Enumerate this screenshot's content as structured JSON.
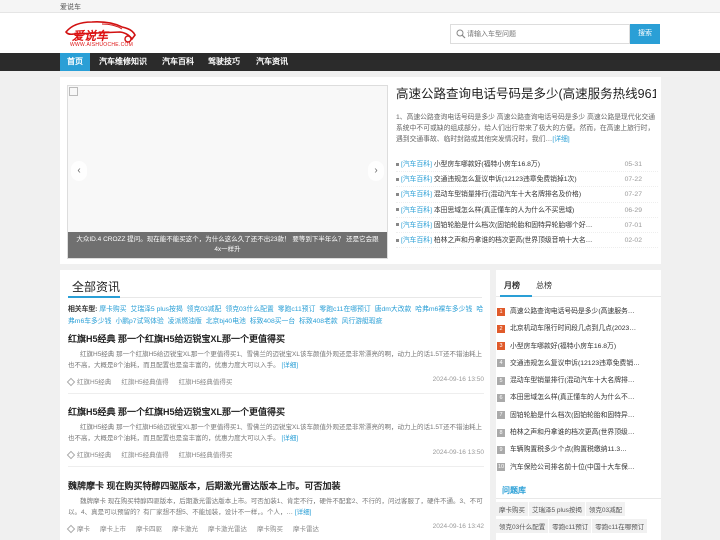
{
  "topbar": {
    "site_name": "爱说车"
  },
  "logo": {
    "brand": "爱说车",
    "url": "WWW.AISHUOCHE.COM"
  },
  "search": {
    "placeholder": "请输入车型问题",
    "button": "搜索"
  },
  "nav": [
    "首页",
    "汽车维修知识",
    "汽车百科",
    "驾驶技巧",
    "汽车资讯"
  ],
  "slider": {
    "caption": "大众ID.4 CROZZ 提问。现在能不能买这个，为什么这么久了还不出23款！ 要等到下半年么？ 还是它会跟4x一样升",
    "prev": "‹",
    "next": "›"
  },
  "feature": {
    "title": "高速公路查询电话号码是多少(高速服务热线961",
    "desc": "1、高速公路查询电话号码是多少 高速公路查询电话号码是多少 高速公路是现代化交通系统中不可或缺的组成部分，给人们出行带来了极大的方便。然而，在高速上旅行时，遇到交通事故、临时封路或其他突发情况时，我们…",
    "more": "[详细]"
  },
  "feature_list": [
    {
      "cat": "[汽车百科]",
      "title": "小型房车哪款好(福特小房车16.8万)",
      "date": "05-31"
    },
    {
      "cat": "[汽车百科]",
      "title": "交通违规怎么复议申诉(12123违章免费销掉1次)",
      "date": "07-22"
    },
    {
      "cat": "[汽车百科]",
      "title": "混动车型销量排行(混动汽车十大名牌排名及价格)",
      "date": "07-27"
    },
    {
      "cat": "[汽车百科]",
      "title": "本田思域怎么样(真正懂车的人为什么不买思域)",
      "date": "06-29"
    },
    {
      "cat": "[汽车百科]",
      "title": "固铂轮胎是什么档次(固铂轮胎和固特异轮胎哪个好…",
      "date": "07-01"
    },
    {
      "cat": "[汽车百科]",
      "title": "柏林之声和丹拿谁的档次更高(世界顶级音响十大名…",
      "date": "02-02"
    }
  ],
  "main": {
    "section_title": "全部资讯",
    "hot_label": "相关车型:",
    "hot_tags": [
      "摩卡购买",
      "艾瑞泽5 plus按揭",
      "领克03减配",
      "领克03什么配置",
      "零跑c11预订",
      "零跑c11在哪预订",
      "唐dm大改款",
      "哈弗m6裸车多少钱",
      "哈弗m6车多少钱",
      "小鹏p7试驾体验",
      "凌派燃油版",
      "北京bj40电池",
      "标致408买一台",
      "标致408老款",
      "风行游艇瑕疵"
    ],
    "articles": [
      {
        "title": "红旗H5经典 那一个红旗H5给迈锐宝XL那一个更值得买",
        "desc": "红旗H5经典 那一个红旗H5给迈锐宝XL那一个更值得买1、雪佛兰的迈锐宝XL该车颜值外观还是非常漂亮的啊，动力上的话1.5T还不错油耗上也不高，大概是8个油耗，而且配置也是蛮丰富的，优惠力度大可以入手。",
        "more": "[详细]",
        "tags": [
          "红旗H5经典",
          "红旗H5经典值得",
          "红旗H5经典值得买"
        ],
        "date": "2024-09-16 13:50"
      },
      {
        "title": "红旗H5经典 那一个红旗H5给迈锐宝XL那一个更值得买",
        "desc": "红旗H5经典 那一个红旗H5给迈锐宝XL那一个更值得买1、雪佛兰的迈锐宝XL该车颜值外观还是非常漂亮的啊，动力上的话1.5T还不错油耗上也不高，大概是8个油耗，而且配置也是蛮丰富的，优惠力度大可以入手。",
        "more": "[详细]",
        "tags": [
          "红旗H5经典",
          "红旗H5经典值得",
          "红旗H5经典值得买"
        ],
        "date": "2024-09-16 13:50"
      },
      {
        "title": "魏牌摩卡 现在购买特醇四驱版本，后期激光雷达版本上市。可否加装",
        "desc": "魏牌摩卡 现在购买特醇四驱版本，后期激光雷达版本上市。可否加装1、肯定不行，硬件不配套2、不行的，问过客服了，硬件不通。3、不可以。4、真是可以预留的？有厂家想不想5、不能加装，设计不一样，。个人，…",
        "more": "[详细]",
        "tags": [
          "摩卡",
          "摩卡上市",
          "摩卡四驱",
          "摩卡激光",
          "摩卡激光雷达",
          "摩卡购买",
          "摩卡雷达"
        ],
        "date": "2024-09-16 13:42"
      }
    ]
  },
  "sidebar": {
    "tabs": [
      "月榜",
      "总榜"
    ],
    "rank": [
      {
        "num": "1",
        "title": "高速公路查询电话号码是多少(高速服务…"
      },
      {
        "num": "2",
        "title": "北京机动车限行时间段几点到几点(2023…"
      },
      {
        "num": "3",
        "title": "小型房车哪款好(福特小房车16.8万)"
      },
      {
        "num": "4",
        "title": "交通违规怎么复议申诉(12123违章免费销…"
      },
      {
        "num": "5",
        "title": "混动车型销量排行(混动汽车十大名牌排…"
      },
      {
        "num": "6",
        "title": "本田思域怎么样(真正懂车的人为什么不…"
      },
      {
        "num": "7",
        "title": "固铂轮胎是什么档次(固铂轮胎和固特异…"
      },
      {
        "num": "8",
        "title": "柏林之声和丹拿谁的档次更高(世界顶级…"
      },
      {
        "num": "9",
        "title": "车辆购置税多少个点(购置税缴纳11.3…"
      },
      {
        "num": "10",
        "title": "汽车保险公司排名前十位(中国十大车保…"
      }
    ],
    "wenti_title": "问题库",
    "wenti_tags": [
      "摩卡购买",
      "艾瑞泽5 plus按揭",
      "领克03减配",
      "领克03什么配置",
      "零跑c11预订",
      "零跑c11在哪预订"
    ]
  },
  "colors": {
    "accent": "#2a9fd6",
    "nav_bg": "#2b2b2b",
    "brand_red": "#d11111",
    "rank_hot": "#e05a2a"
  }
}
